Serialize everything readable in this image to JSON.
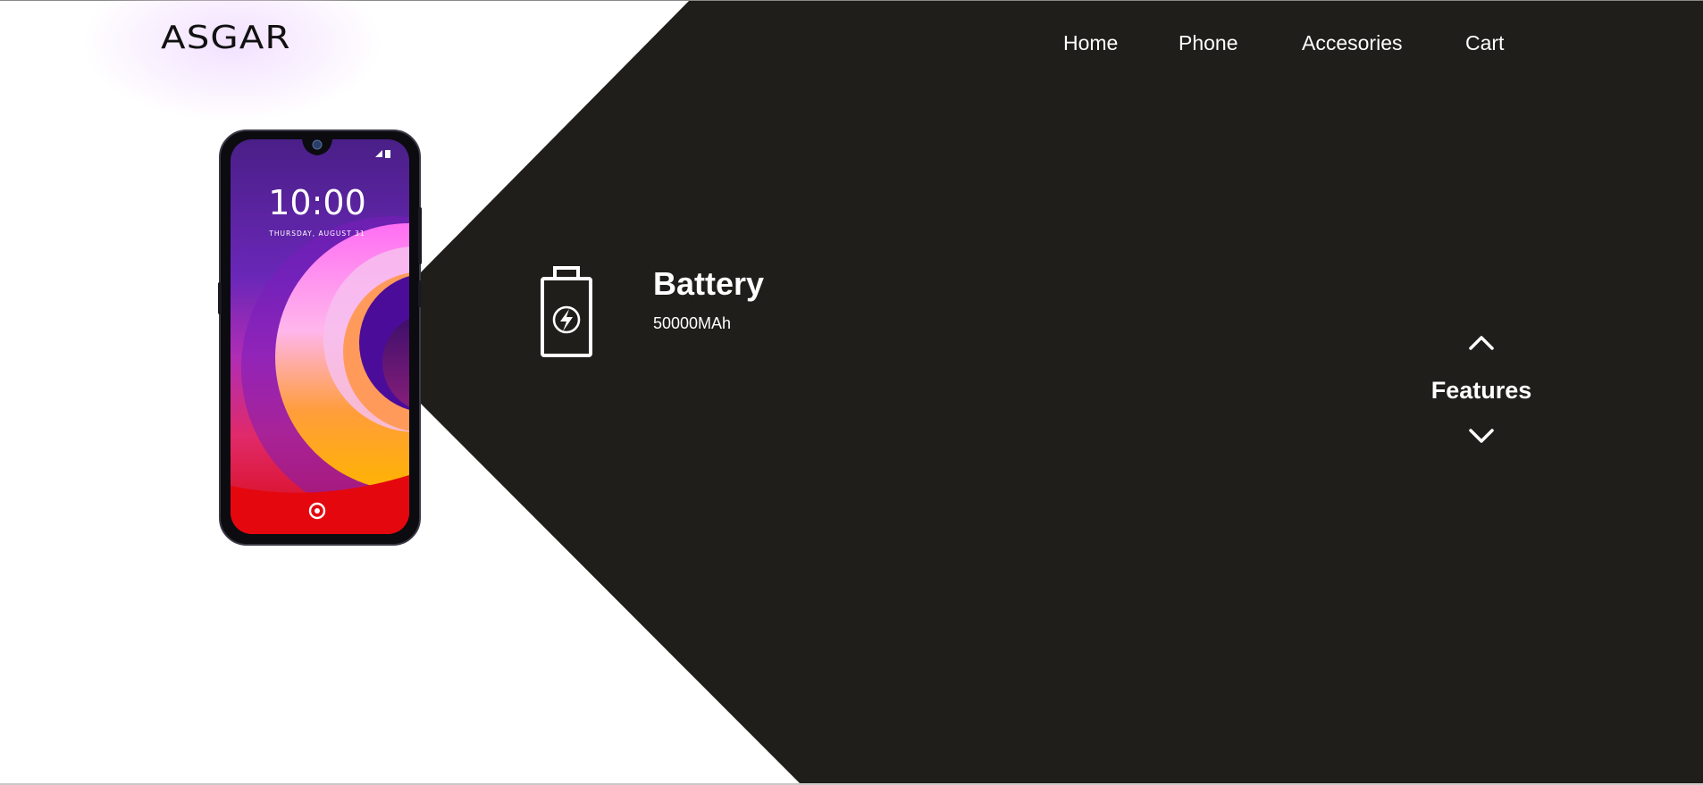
{
  "brand": {
    "logo_text": "ASGAR"
  },
  "nav": {
    "items": [
      {
        "label": "Home"
      },
      {
        "label": "Phone"
      },
      {
        "label": "Accesories"
      },
      {
        "label": "Cart"
      }
    ]
  },
  "phone": {
    "clock_time": "10:00",
    "clock_date": "THURSDAY, AUGUST 31"
  },
  "feature": {
    "icon": "battery-charging-icon",
    "title": "Battery",
    "value": "50000MAh"
  },
  "selector": {
    "label": "Features",
    "up_icon": "chevron-up-icon",
    "down_icon": "chevron-down-icon"
  },
  "colors": {
    "dark_panel": "#201e1a",
    "background": "#ffffff",
    "text_light": "#ffffff",
    "text_dark": "#111111"
  }
}
